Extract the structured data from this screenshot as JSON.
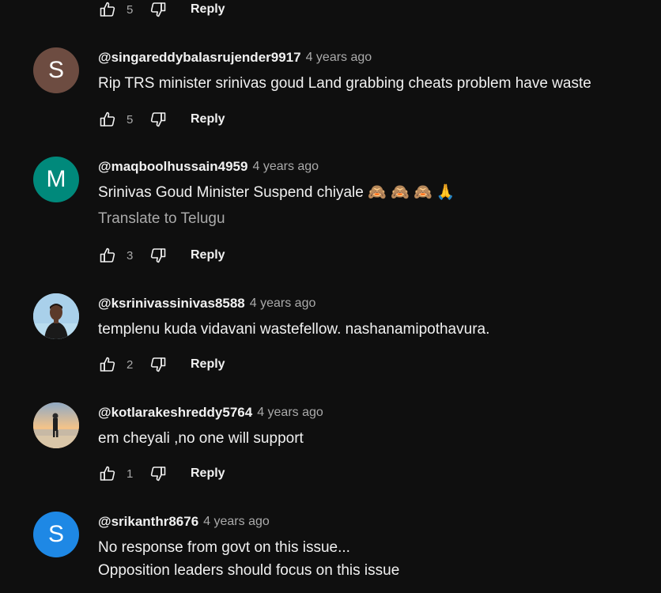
{
  "reply_label": "Reply",
  "top_actions": {
    "likes": "5"
  },
  "comments": [
    {
      "author": "@singareddybalasrujender9917",
      "time": "4 years ago",
      "avatar_letter": "S",
      "avatar_color": "#6d4c41",
      "lines": [
        "Rip TRS minister srinivas goud Land grabbing cheats problem have waste"
      ],
      "likes": "5"
    },
    {
      "author": "@maqboolhussain4959",
      "time": "4 years ago",
      "avatar_letter": "M",
      "avatar_color": "#00897b",
      "lines": [
        "Srinivas Goud Minister Suspend chiyale 🙈 🙈 🙈 🙏"
      ],
      "translate": "Translate to Telugu",
      "likes": "3"
    },
    {
      "author": "@ksrinivassinivas8588",
      "time": "4 years ago",
      "avatar_photo": "person-photo",
      "lines": [
        "templenu kuda vidavani wastefellow. nashanamipothavura."
      ],
      "likes": "2"
    },
    {
      "author": "@kotlarakeshreddy5764",
      "time": "4 years ago",
      "avatar_photo": "beach-sunset-photo",
      "lines": [
        "em cheyali ,no one will support"
      ],
      "likes": "1"
    },
    {
      "author": "@srikanthr8676",
      "time": "4 years ago",
      "avatar_letter": "S",
      "avatar_color": "#1e88e5",
      "lines": [
        "No response from govt on this issue...",
        "Opposition leaders should focus on this issue"
      ]
    }
  ]
}
